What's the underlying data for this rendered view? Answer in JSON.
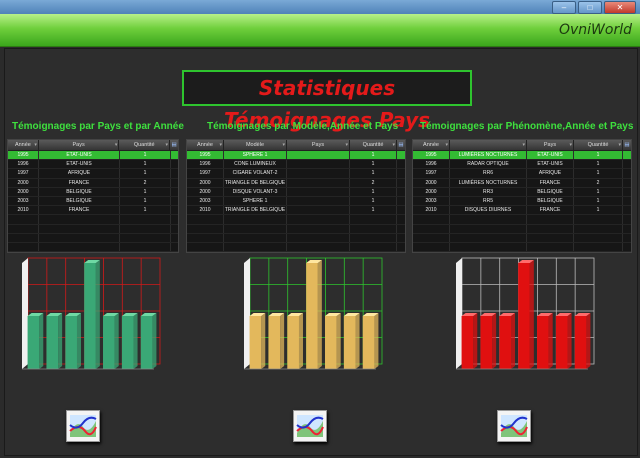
{
  "window": {
    "brand": "OvniWorld",
    "controls": [
      "–",
      "□",
      "✕"
    ]
  },
  "page_title": "Statistiques Témoignages Pays",
  "sections": [
    {
      "title": "Témoignages par Pays et par Année",
      "columns": [
        "Année",
        "Pays",
        "Quantité"
      ],
      "rows": [
        [
          "1995",
          "ETAT-UNIS",
          "1"
        ],
        [
          "1996",
          "ETAT-UNIS",
          "1"
        ],
        [
          "1997",
          "AFRIQUE",
          "1"
        ],
        [
          "2000",
          "FRANCE",
          "2"
        ],
        [
          "2000",
          "BELGIQUE",
          "1"
        ],
        [
          "2003",
          "BELGIQUE",
          "1"
        ],
        [
          "2010",
          "FRANCE",
          "1"
        ]
      ],
      "selected_row": 0
    },
    {
      "title": "Témoignages par Modèle,Année et Pays",
      "columns": [
        "Année",
        "Modèle",
        "Pays",
        "Quantité"
      ],
      "rows": [
        [
          "1995",
          "SPHERE 1",
          "",
          "1"
        ],
        [
          "1996",
          "CONE LUMINEUX",
          "",
          "1"
        ],
        [
          "1997",
          "CIGARE VOLANT-2",
          "",
          "1"
        ],
        [
          "2000",
          "TRIANGLE DE BELGIQUE",
          "",
          "2"
        ],
        [
          "2000",
          "DISQUE VOLANT-3",
          "",
          "1"
        ],
        [
          "2003",
          "SPHERE 1",
          "",
          "1"
        ],
        [
          "2010",
          "TRIANGLE DE BELGIQUE",
          "",
          "1"
        ]
      ],
      "selected_row": 0
    },
    {
      "title": "Témoignages par Phénomène,Année et Pays",
      "columns": [
        "Année",
        "",
        "Pays",
        "Quantité"
      ],
      "rows": [
        [
          "1995",
          "LUMIÈRES NOCTURNES",
          "ETAT-UNIS",
          "1"
        ],
        [
          "1996",
          "RADAR OPTIQUE",
          "ETAT-UNIS",
          "1"
        ],
        [
          "1997",
          "RR6",
          "AFRIQUE",
          "1"
        ],
        [
          "2000",
          "LUMIÈRES NOCTURNES",
          "FRANCE",
          "2"
        ],
        [
          "2000",
          "RR3",
          "BELGIQUE",
          "1"
        ],
        [
          "2003",
          "RR5",
          "BELGIQUE",
          "1"
        ],
        [
          "2010",
          "DISQUES DIURNES",
          "FRANCE",
          "1"
        ]
      ],
      "selected_row": 0
    }
  ],
  "charts": [
    {
      "values": [
        1,
        1,
        1,
        2,
        1,
        1,
        1
      ],
      "ylim": [
        0,
        2
      ],
      "color": "#3aa876",
      "top": "#6fd9a4",
      "grid": "#d11a1a"
    },
    {
      "values": [
        1,
        1,
        1,
        2,
        1,
        1,
        1
      ],
      "ylim": [
        0,
        2
      ],
      "color": "#e3b85c",
      "top": "#ffe7a0",
      "grid": "#2ec42e"
    },
    {
      "values": [
        1,
        1,
        1,
        2,
        1,
        1,
        1
      ],
      "ylim": [
        0,
        2
      ],
      "color": "#e01010",
      "top": "#ff6b6b",
      "grid": "#bbbbbb"
    }
  ],
  "icons": [
    "chart-image-icon",
    "chart-image-icon",
    "chart-image-icon"
  ]
}
